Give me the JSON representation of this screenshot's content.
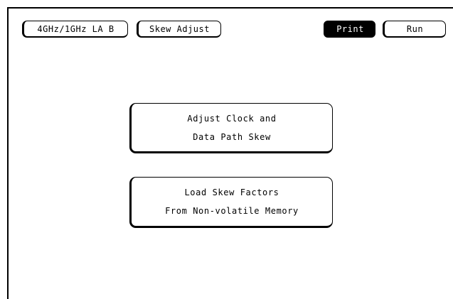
{
  "header": {
    "mode_label": "4GHz/1GHz LA B",
    "menu_label": "Skew Adjust",
    "print_label": "Print",
    "run_label": "Run"
  },
  "main": {
    "adjust_line1": "Adjust Clock and",
    "adjust_line2": "Data Path Skew",
    "load_line1": "Load Skew Factors",
    "load_line2": "From Non-volatile Memory"
  },
  "colors": {
    "background": "#ffffff",
    "foreground": "#000000"
  }
}
